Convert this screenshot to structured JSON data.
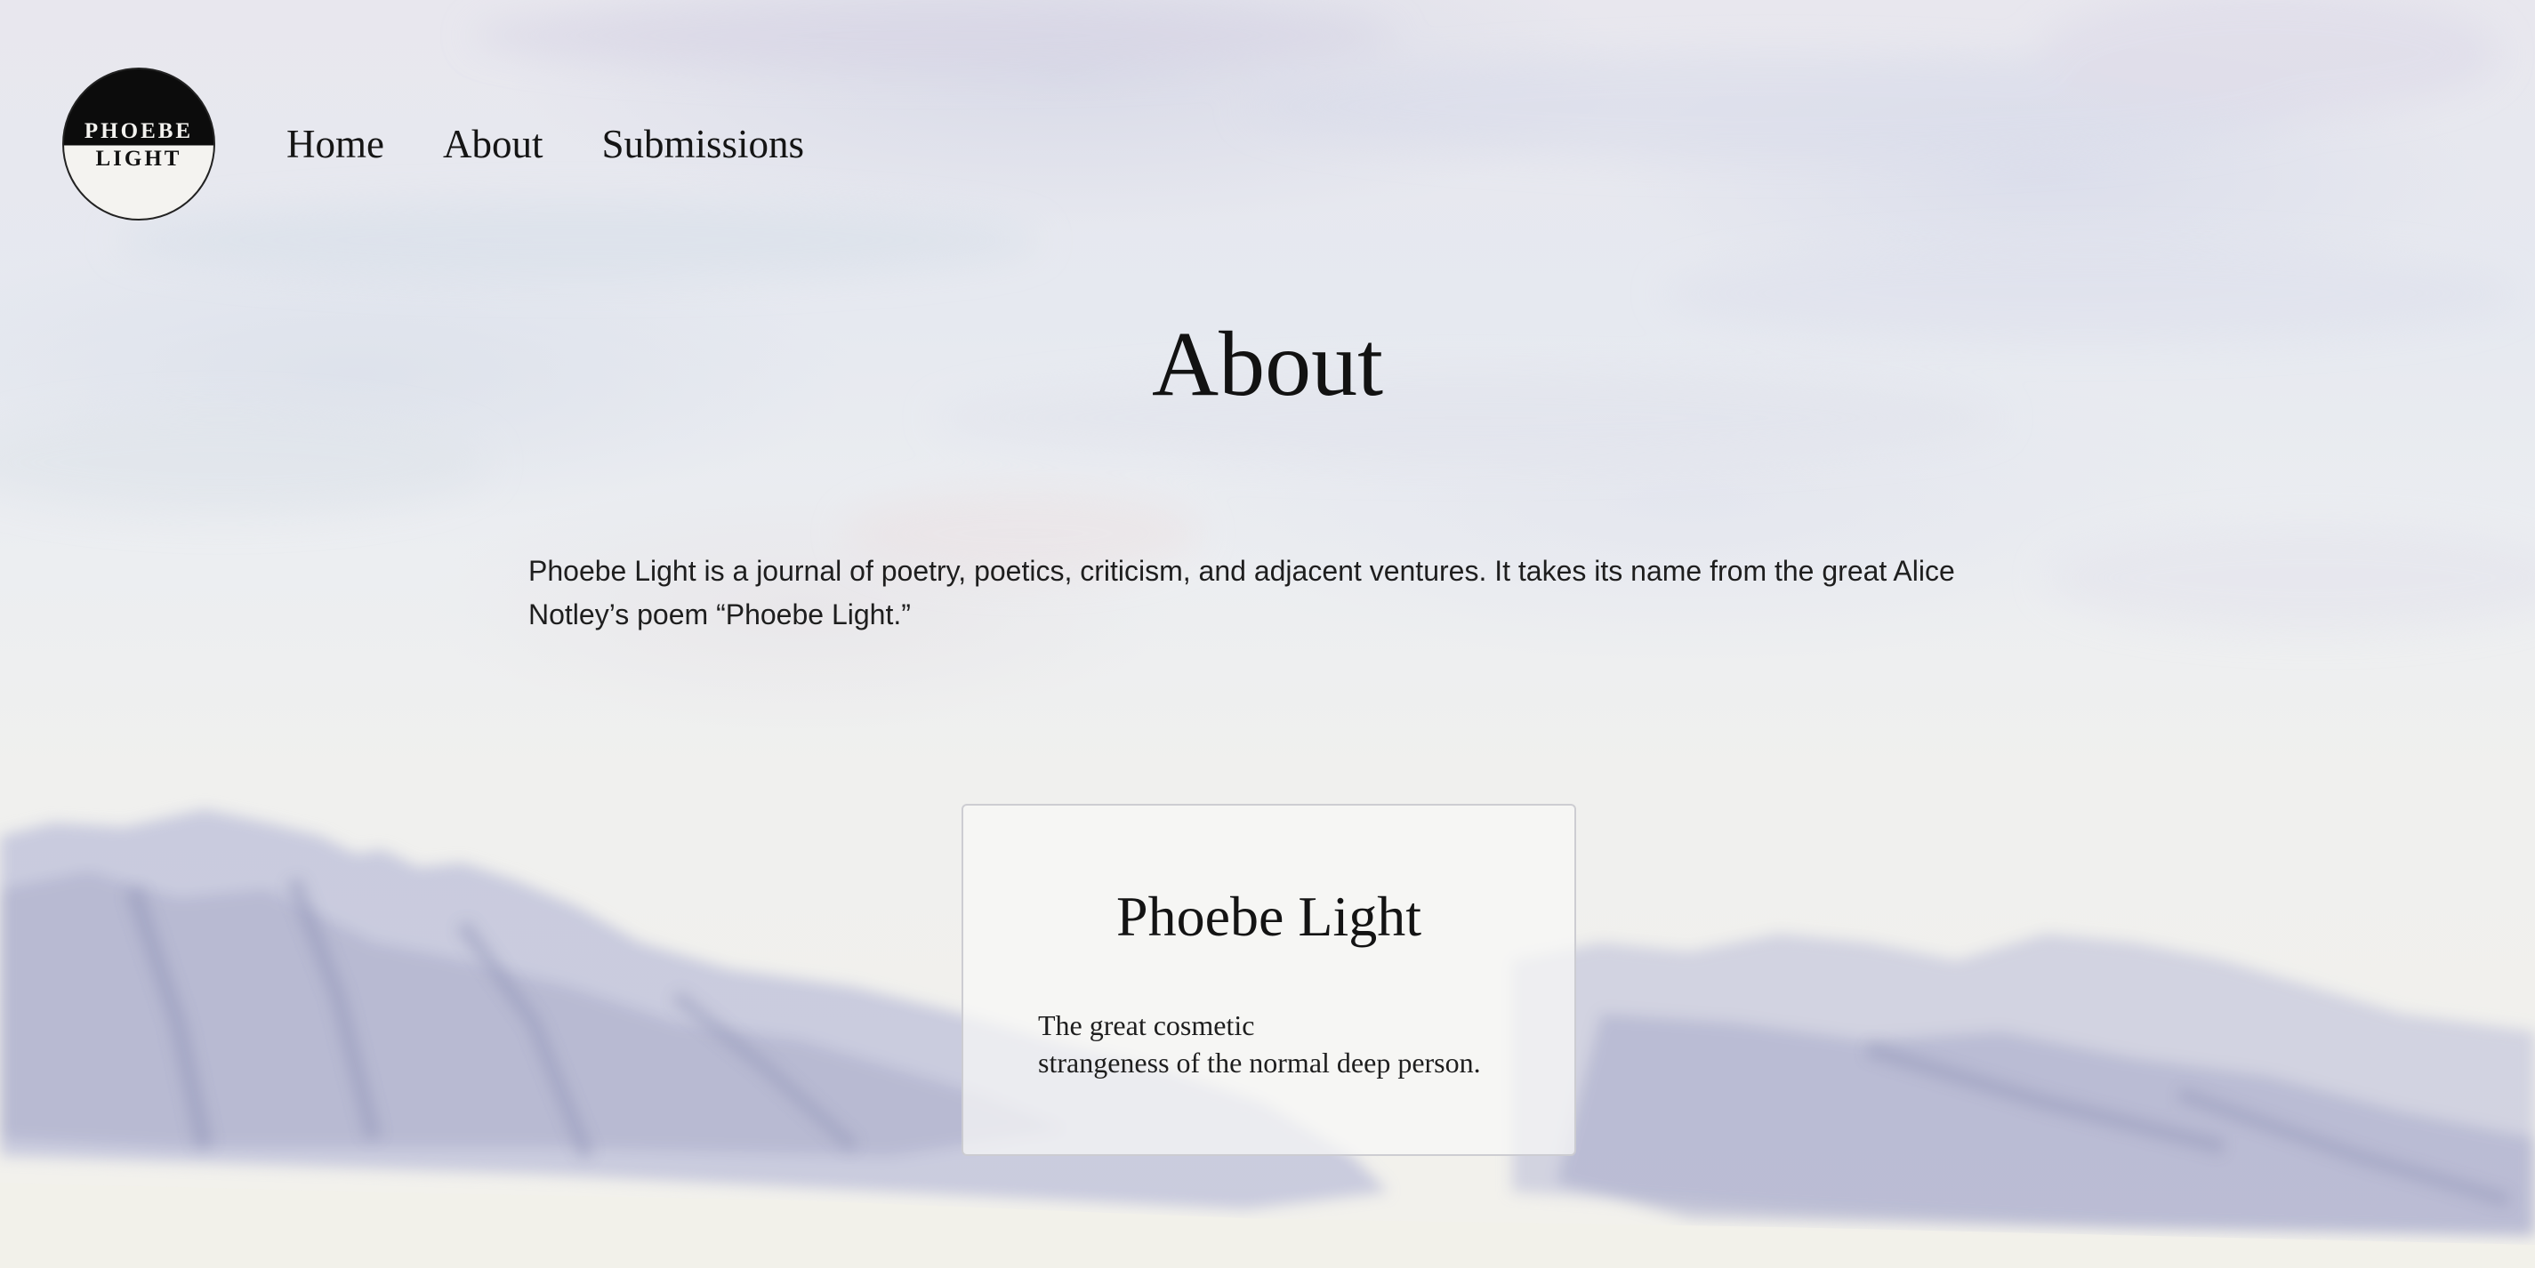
{
  "logo": {
    "line1": "PHOEBE",
    "line2": "LIGHT"
  },
  "nav": {
    "items": [
      {
        "label": "Home"
      },
      {
        "label": "About"
      },
      {
        "label": "Submissions"
      }
    ]
  },
  "main": {
    "title": "About",
    "intro": "Phoebe Light is a journal of poetry, poetics, criticism, and adjacent ventures. It takes its name from the great Alice Notley’s poem “Phoebe Light.”"
  },
  "card": {
    "title": "Phoebe Light",
    "quote_lines": [
      "The great cosmetic",
      "strangeness of the normal deep person."
    ]
  },
  "colors": {
    "text": "#161616",
    "logo_dark": "#0c0c0c",
    "sky": "#e6e9f0",
    "mountains": "#b9bcd6"
  }
}
